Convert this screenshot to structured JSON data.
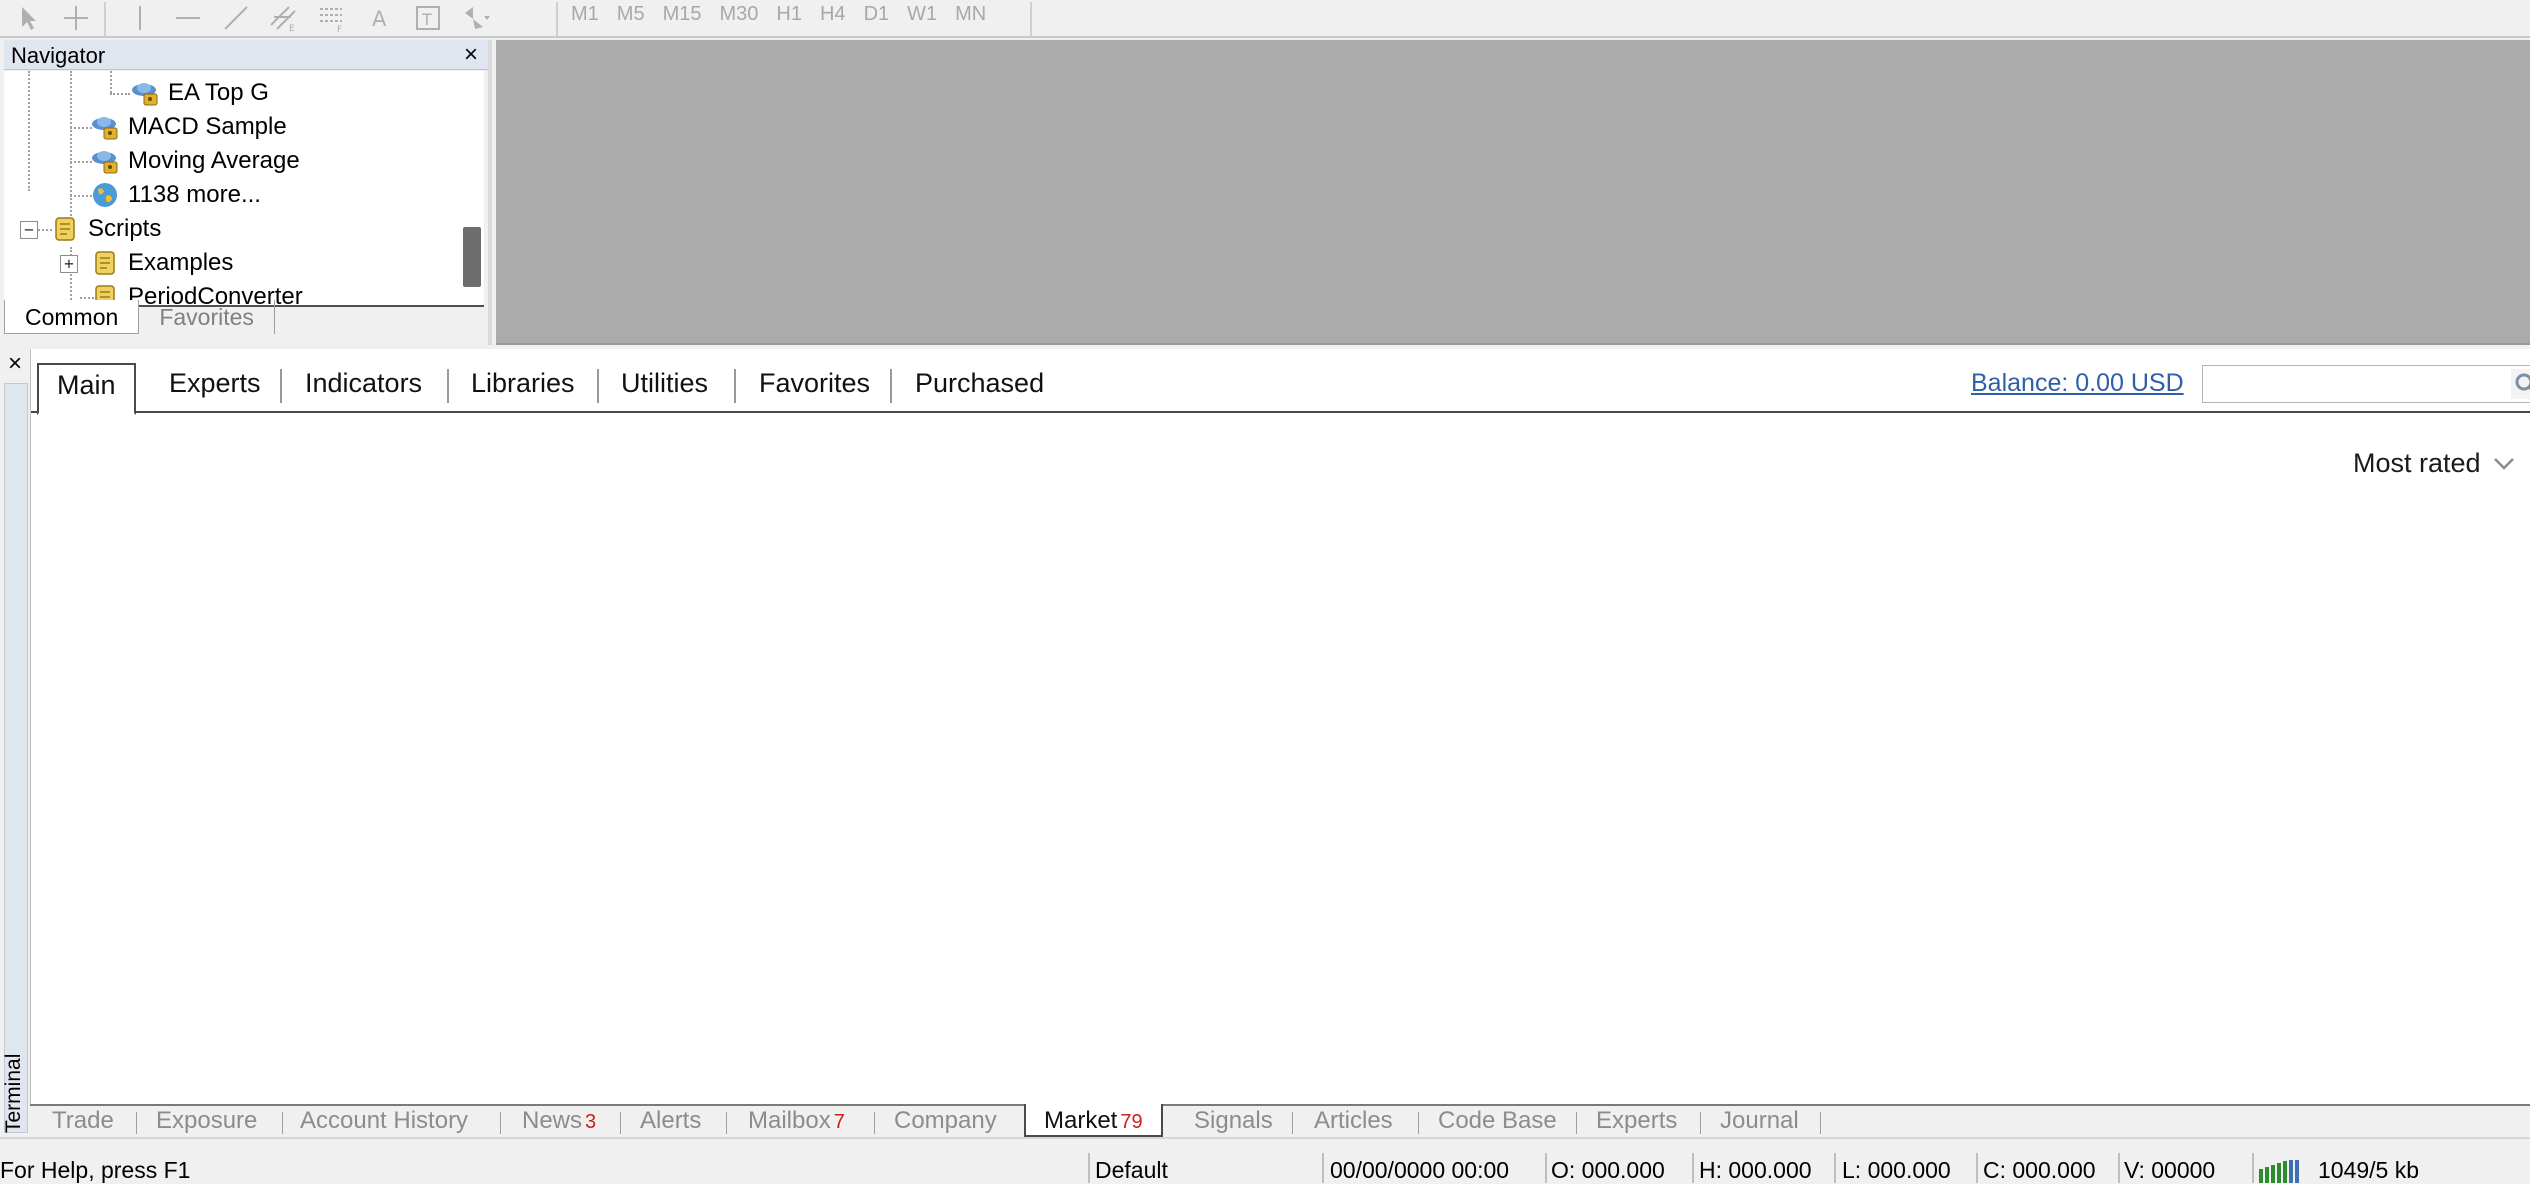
{
  "toolbar": {
    "drawing_tools": [
      "cursor-icon",
      "crosshair-icon",
      "vertical-line-icon",
      "horizontal-line-icon",
      "trendline-icon",
      "equidistant-channel-icon",
      "fibonacci-icon",
      "text-icon",
      "text-label-icon",
      "arrows-icon"
    ],
    "timeframes": [
      "M1",
      "M5",
      "M15",
      "M30",
      "H1",
      "H4",
      "D1",
      "W1",
      "MN"
    ]
  },
  "navigator": {
    "title": "Navigator",
    "close": "×",
    "tree": [
      {
        "label": "EA Top G",
        "icon": "expert-advisor-icon"
      },
      {
        "label": "MACD Sample",
        "icon": "expert-advisor-icon"
      },
      {
        "label": "Moving Average",
        "icon": "expert-advisor-icon"
      },
      {
        "label": "1138 more...",
        "icon": "globe-icon"
      },
      {
        "label": "Scripts",
        "icon": "script-icon",
        "expander": "−"
      },
      {
        "label": "Examples",
        "icon": "script-icon",
        "expander": "+"
      },
      {
        "label": "PeriodConverter",
        "icon": "script-icon"
      }
    ],
    "tabs": [
      "Common",
      "Favorites"
    ]
  },
  "terminal": {
    "close": "×",
    "side_label": "Terminal",
    "market": {
      "tabs": [
        "Main",
        "Experts",
        "Indicators",
        "Libraries",
        "Utilities",
        "Favorites",
        "Purchased"
      ],
      "active_tab": "Main",
      "balance": "Balance: 0.00 USD",
      "search_placeholder": "",
      "sort": "Most rated"
    },
    "tabs": [
      {
        "label": "Trade",
        "badge": ""
      },
      {
        "label": "Exposure",
        "badge": ""
      },
      {
        "label": "Account History",
        "badge": ""
      },
      {
        "label": "News",
        "badge": "3"
      },
      {
        "label": "Alerts",
        "badge": ""
      },
      {
        "label": "Mailbox",
        "badge": "7"
      },
      {
        "label": "Company",
        "badge": ""
      },
      {
        "label": "Market",
        "badge": "79"
      },
      {
        "label": "Signals",
        "badge": ""
      },
      {
        "label": "Articles",
        "badge": ""
      },
      {
        "label": "Code Base",
        "badge": ""
      },
      {
        "label": "Experts",
        "badge": ""
      },
      {
        "label": "Journal",
        "badge": ""
      }
    ],
    "active_tab": "Market"
  },
  "statusbar": {
    "help": "For Help, press F1",
    "profile": "Default",
    "datetime": "00/00/0000 00:00",
    "open": "O: 000.000",
    "high": "H: 000.000",
    "low": "L: 000.000",
    "close": "C: 000.000",
    "volume": "V: 00000",
    "traffic": "1049/5 kb"
  },
  "colors": {
    "chart_background": "#ababab",
    "link": "#2f5fa9",
    "badge": "#d01c1c",
    "navigator_header": "#dfe6f0"
  }
}
